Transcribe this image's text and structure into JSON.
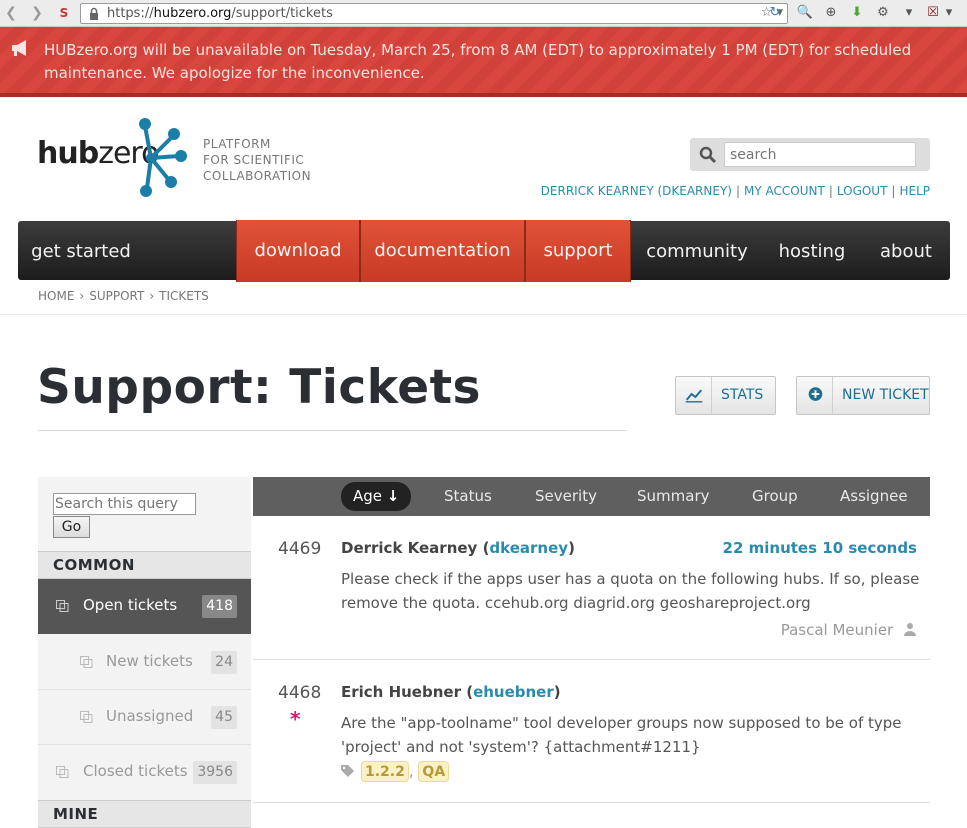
{
  "browser": {
    "url_prefix": "https://",
    "url_domain": "hubzero.org",
    "url_path": "/support/tickets"
  },
  "banner": {
    "message": "HUBzero.org will be unavailable on Tuesday, March 25, from 8 AM (EDT) to approximately 1 PM (EDT) for scheduled maintenance. We apologize for the inconvenience."
  },
  "header": {
    "logo_hub": "hub",
    "logo_zero": "zero",
    "tagline": [
      "PLATFORM",
      "FOR SCIENTIFIC",
      "COLLABORATION"
    ],
    "search_placeholder": "search",
    "user_links": {
      "user": "DERRICK KEARNEY (DKEARNEY)",
      "account": "MY ACCOUNT",
      "logout": "LOGOUT",
      "help": "HELP"
    }
  },
  "nav": {
    "items": [
      "get started",
      "download",
      "documentation",
      "support",
      "community",
      "hosting",
      "about"
    ]
  },
  "breadcrumb": [
    "HOME",
    "SUPPORT",
    "TICKETS"
  ],
  "page": {
    "title": "Support: Tickets",
    "stats_label": "STATS",
    "new_ticket_label": "NEW TICKET"
  },
  "sidebar": {
    "query_placeholder": "Search this query",
    "go_label": "Go",
    "common_heading": "COMMON",
    "mine_heading": "MINE",
    "queries": [
      {
        "label": "Open tickets",
        "count": "418"
      },
      {
        "label": "New tickets",
        "count": "24"
      },
      {
        "label": "Unassigned",
        "count": "45"
      },
      {
        "label": "Closed tickets",
        "count": "3956"
      }
    ]
  },
  "sort": {
    "columns": [
      "Age",
      "Status",
      "Severity",
      "Summary",
      "Group",
      "Assignee"
    ],
    "active_arrow": "↓"
  },
  "tickets": [
    {
      "id": "4469",
      "name": "Derrick Kearney",
      "username": "dkearney",
      "age": "22 minutes 10 seconds",
      "summary": "Please check if the apps user has a quota on the following hubs. If so, please remove the quota. ccehub.org diagrid.org geoshareproject.org",
      "owner": "Pascal Meunier"
    },
    {
      "id": "4468",
      "name": "Erich Huebner",
      "username": "ehuebner",
      "star": "*",
      "summary": "Are the \"app-toolname\" tool developer groups now supposed to be of type 'project' and not 'system'? {attachment#1211}",
      "tags": [
        "1.2.2",
        "QA"
      ]
    }
  ],
  "colors": {
    "accent": "#2a8bb0",
    "banner": "#d9463d",
    "nav_active": "#d6462d"
  }
}
